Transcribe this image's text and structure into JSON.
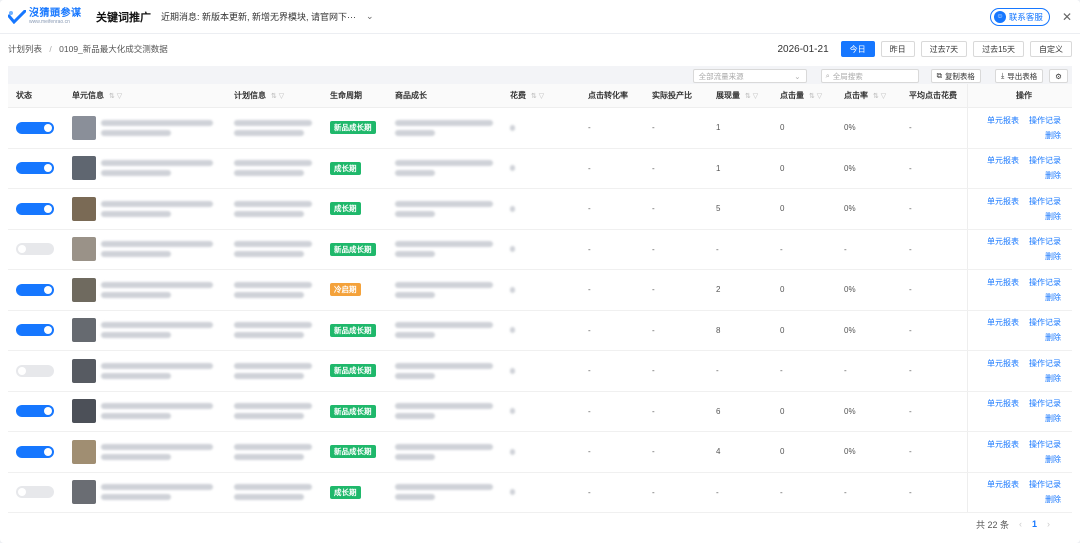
{
  "header": {
    "logo_cn": "沒猜頭参谋",
    "logo_en": "www.meifenrao.cn",
    "title": "关键词推广",
    "notice": "近期消息: 新版本更新, 新增无界模块, 请官网下···",
    "service": "联系客服"
  },
  "breadcrumb": {
    "root": "计划列表",
    "sep": "/",
    "current": "0109_新品最大化成交测数据"
  },
  "date_bar": {
    "date": "2026-01-21",
    "buttons": [
      "今日",
      "昨日",
      "过去7天",
      "过去15天",
      "自定义"
    ]
  },
  "toolbar": {
    "source_placeholder": "全部流量来源",
    "search_placeholder": "全局搜索",
    "copy_table": "复制表格",
    "export_table": "导出表格"
  },
  "columns": [
    "状态",
    "单元信息",
    "计划信息",
    "生命周期",
    "商品成长",
    "花费",
    "点击转化率",
    "实际投产比",
    "展现量",
    "点击量",
    "点击率",
    "平均点击花费",
    "操作"
  ],
  "ops": {
    "report": "单元报表",
    "log": "操作记录",
    "delete": "删除"
  },
  "rows": [
    {
      "on": true,
      "stage": "新品成长期",
      "stage_color": "g",
      "cvr": "-",
      "roi": "-",
      "imp": "1",
      "clk": "0",
      "ctr": "0%",
      "cpc": "-"
    },
    {
      "on": true,
      "stage": "成长期",
      "stage_color": "g",
      "cvr": "-",
      "roi": "-",
      "imp": "1",
      "clk": "0",
      "ctr": "0%",
      "cpc": "-"
    },
    {
      "on": true,
      "stage": "成长期",
      "stage_color": "g",
      "cvr": "-",
      "roi": "-",
      "imp": "5",
      "clk": "0",
      "ctr": "0%",
      "cpc": "-"
    },
    {
      "on": false,
      "stage": "新品成长期",
      "stage_color": "g",
      "cvr": "-",
      "roi": "-",
      "imp": "-",
      "clk": "-",
      "ctr": "-",
      "cpc": "-"
    },
    {
      "on": true,
      "stage": "冷启期",
      "stage_color": "o",
      "cvr": "-",
      "roi": "-",
      "imp": "2",
      "clk": "0",
      "ctr": "0%",
      "cpc": "-"
    },
    {
      "on": true,
      "stage": "新品成长期",
      "stage_color": "g",
      "cvr": "-",
      "roi": "-",
      "imp": "8",
      "clk": "0",
      "ctr": "0%",
      "cpc": "-"
    },
    {
      "on": false,
      "stage": "新品成长期",
      "stage_color": "g",
      "cvr": "-",
      "roi": "-",
      "imp": "-",
      "clk": "-",
      "ctr": "-",
      "cpc": "-"
    },
    {
      "on": true,
      "stage": "新品成长期",
      "stage_color": "g",
      "cvr": "-",
      "roi": "-",
      "imp": "6",
      "clk": "0",
      "ctr": "0%",
      "cpc": "-"
    },
    {
      "on": true,
      "stage": "新品成长期",
      "stage_color": "g",
      "cvr": "-",
      "roi": "-",
      "imp": "4",
      "clk": "0",
      "ctr": "0%",
      "cpc": "-"
    },
    {
      "on": false,
      "stage": "成长期",
      "stage_color": "g",
      "cvr": "-",
      "roi": "-",
      "imp": "-",
      "clk": "-",
      "ctr": "-",
      "cpc": "-"
    }
  ],
  "pagination": {
    "total": "共 22 条",
    "current": "1"
  }
}
